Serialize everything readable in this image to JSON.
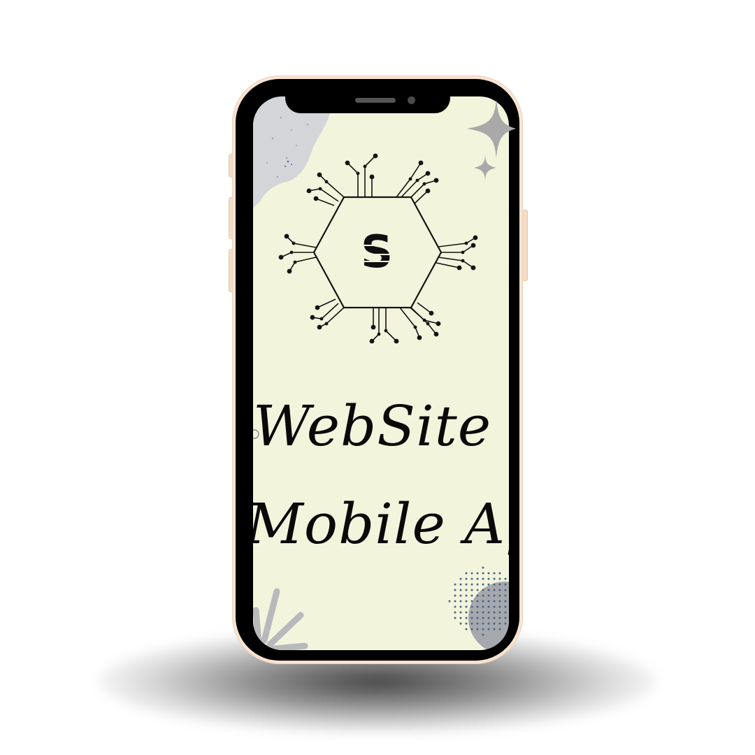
{
  "phone": {
    "frame_color": "#f8e3d1",
    "bezel_color": "#000000",
    "screen_background": "#f3f4dc"
  },
  "screen": {
    "logo": {
      "icon": "circuit-hexagon-icon",
      "glyph": "S"
    },
    "title_line_1": "WebSite &",
    "title_line_2": "Mobile App",
    "text_color": "#0a0a0a"
  },
  "decorations": {
    "blob_color": "#d3d5d8",
    "dot_color": "#4a6785",
    "sparkle_color": "#a9a9a9"
  }
}
